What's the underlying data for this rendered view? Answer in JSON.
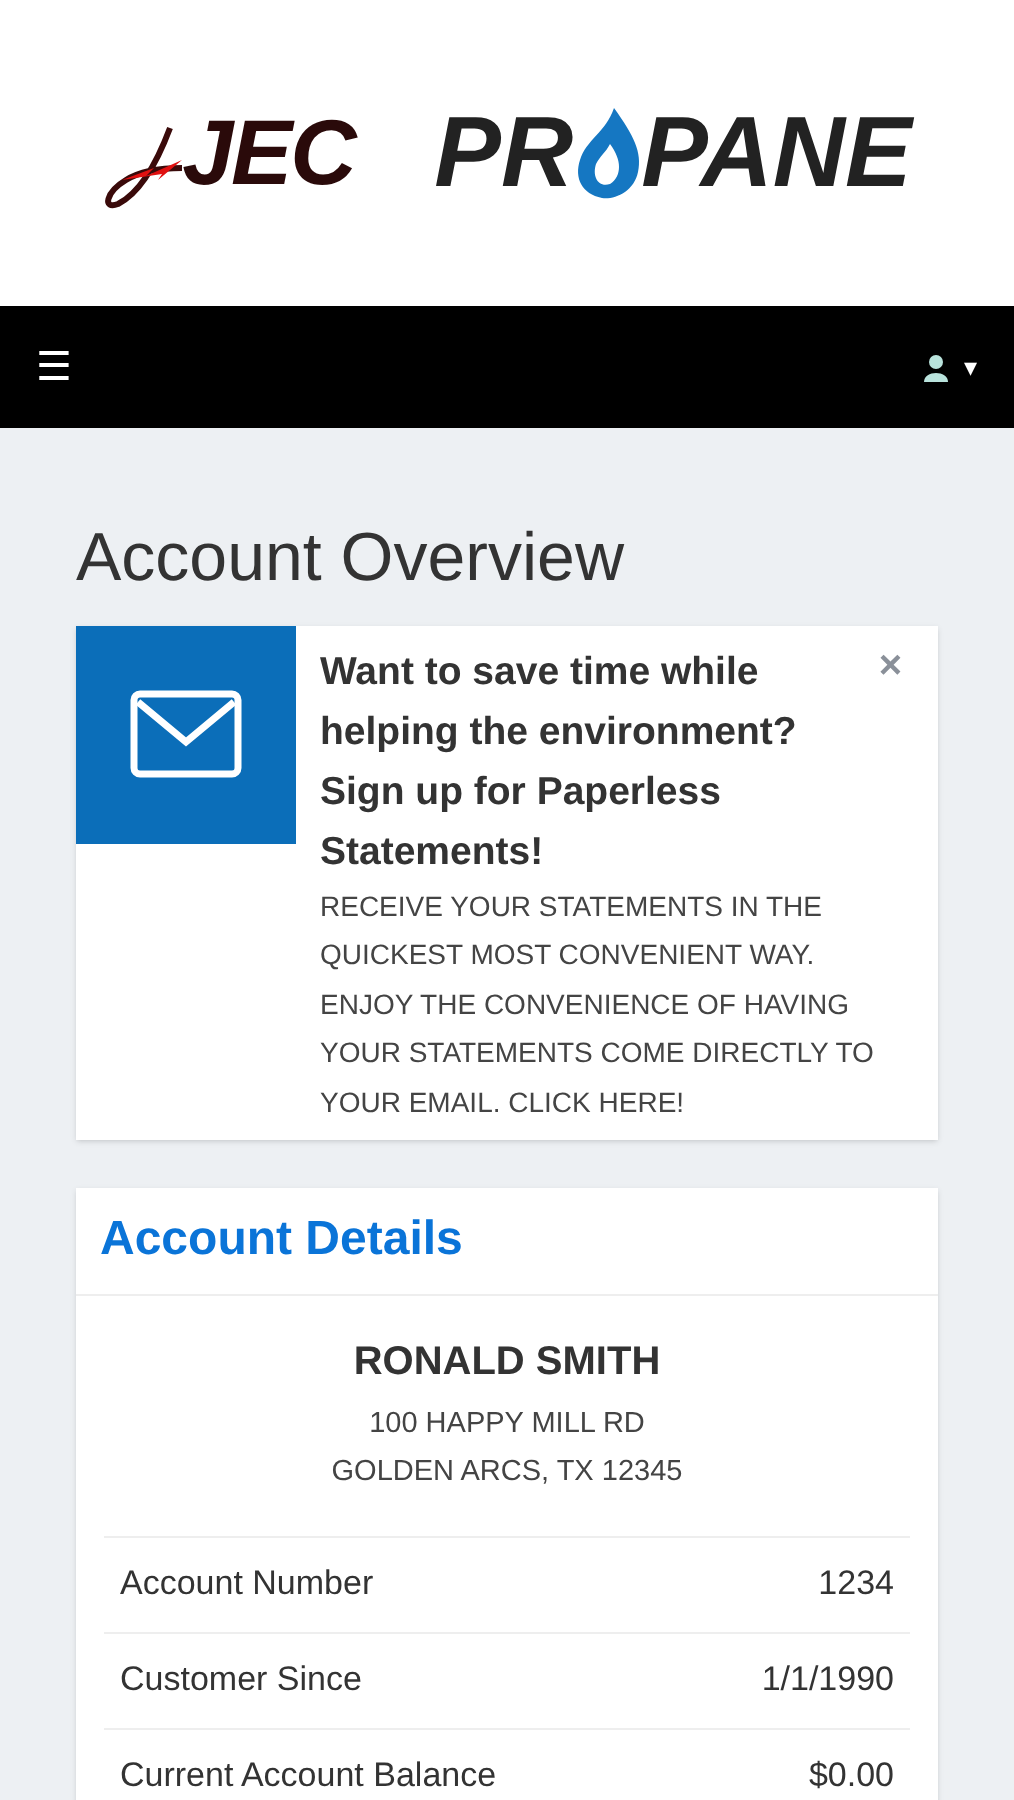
{
  "logo": {
    "mark": "JEC",
    "word_start": "PR",
    "word_end": "PANE"
  },
  "nav": {
    "menu_icon": "☰",
    "user_menu_caret": "▾"
  },
  "page_title": "Account Overview",
  "promo": {
    "headline": "Want to save time while helping the environment? Sign up for Paperless Statements!",
    "body": "RECEIVE YOUR STATEMENTS IN THE QUICKEST MOST CONVENIENT WAY. ENJOY THE CONVENIENCE OF HAVING YOUR STATEMENTS COME DIRECTLY TO YOUR EMAIL. CLICK HERE!",
    "close": "×"
  },
  "account_details": {
    "title": "Account Details",
    "name": "RONALD SMITH",
    "address_lines": [
      "100 HAPPY MILL RD",
      "GOLDEN ARCS, TX 12345"
    ],
    "rows": [
      {
        "label": "Account Number",
        "value": "1234"
      },
      {
        "label": "Customer Since",
        "value": "1/1/1990"
      },
      {
        "label": "Current Account Balance",
        "value": "$0.00"
      }
    ]
  }
}
